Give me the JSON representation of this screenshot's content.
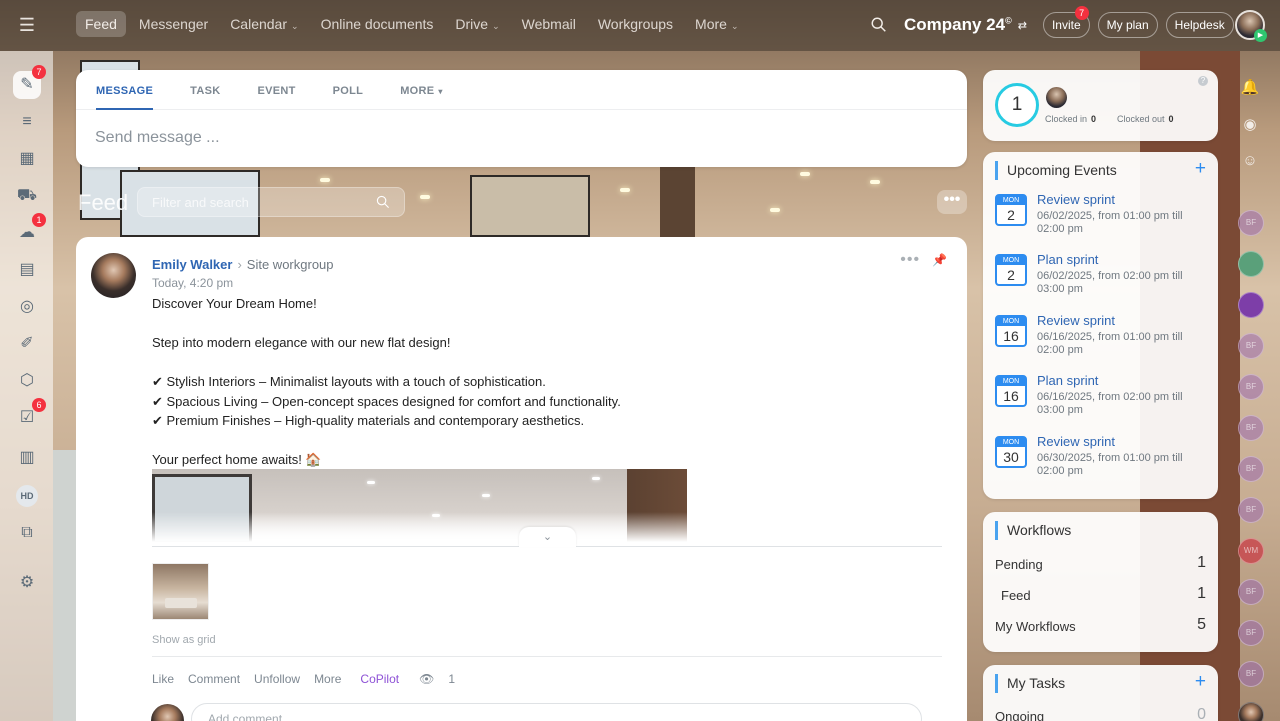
{
  "topbar": {
    "nav": [
      {
        "label": "Feed",
        "active": true,
        "dropdown": false
      },
      {
        "label": "Messenger",
        "active": false,
        "dropdown": false
      },
      {
        "label": "Calendar",
        "active": false,
        "dropdown": true
      },
      {
        "label": "Online documents",
        "active": false,
        "dropdown": false
      },
      {
        "label": "Drive",
        "active": false,
        "dropdown": true
      },
      {
        "label": "Webmail",
        "active": false,
        "dropdown": false
      },
      {
        "label": "Workgroups",
        "active": false,
        "dropdown": false
      },
      {
        "label": "More",
        "active": false,
        "dropdown": true
      }
    ],
    "brand": "Company 24",
    "brand_mark": "©",
    "invite_label": "Invite",
    "invite_badge": "7",
    "plan_label": "My plan",
    "helpdesk_label": "Helpdesk"
  },
  "leftbar": {
    "chat_badge": "7",
    "store_badge": "1",
    "tasks_badge": "6",
    "hd_label": "HD"
  },
  "composer": {
    "tabs": [
      "MESSAGE",
      "TASK",
      "EVENT",
      "POLL",
      "MORE"
    ],
    "placeholder": "Send message ..."
  },
  "feed": {
    "title": "Feed",
    "filter_placeholder": "Filter and search"
  },
  "post": {
    "author": "Emily Walker",
    "group": "Site workgroup",
    "time": "Today, 4:20 pm",
    "lines": [
      "Discover Your Dream Home!",
      "",
      "Step into modern elegance with our new flat design!",
      "",
      "✔ Stylish Interiors – Minimalist layouts with a touch of sophistication.",
      "✔ Spacious Living – Open-concept spaces designed for comfort and functionality.",
      "✔ Premium Finishes – High-quality materials and contemporary aesthetics.",
      "",
      "Your perfect home awaits! 🏠"
    ],
    "show_as_grid": "Show as grid",
    "actions": {
      "like": "Like",
      "comment": "Comment",
      "unfollow": "Unfollow",
      "more": "More",
      "copilot": "CoPilot"
    },
    "views": "1",
    "comment_placeholder": "Add comment"
  },
  "timeman": {
    "count": "1",
    "clocked_in_label": "Clocked in",
    "clocked_in": "0",
    "clocked_out_label": "Clocked out",
    "clocked_out": "0"
  },
  "events": {
    "title": "Upcoming Events",
    "items": [
      {
        "dow": "MON",
        "day": "2",
        "title": "Review sprint",
        "desc": "06/02/2025, from 01:00 pm till 02:00 pm"
      },
      {
        "dow": "MON",
        "day": "2",
        "title": "Plan sprint",
        "desc": "06/02/2025, from 02:00 pm till 03:00 pm"
      },
      {
        "dow": "MON",
        "day": "16",
        "title": "Review sprint",
        "desc": "06/16/2025, from 01:00 pm till 02:00 pm"
      },
      {
        "dow": "MON",
        "day": "16",
        "title": "Plan sprint",
        "desc": "06/16/2025, from 02:00 pm till 03:00 pm"
      },
      {
        "dow": "MON",
        "day": "30",
        "title": "Review sprint",
        "desc": "06/30/2025, from 01:00 pm till 02:00 pm"
      }
    ]
  },
  "workflows": {
    "title": "Workflows",
    "rows": [
      {
        "label": "Pending",
        "count": "1"
      },
      {
        "label": "Feed",
        "count": "1"
      },
      {
        "label": "My Workflows",
        "count": "5"
      }
    ]
  },
  "tasks": {
    "title": "My Tasks",
    "ongoing_label": "Ongoing",
    "ongoing_count": "0"
  },
  "rrail": {
    "avatars": [
      "BF",
      "",
      "",
      "BF",
      "BF",
      "BF",
      "BF",
      "BF",
      "WM",
      "BF",
      "BF",
      "BF",
      ""
    ]
  }
}
